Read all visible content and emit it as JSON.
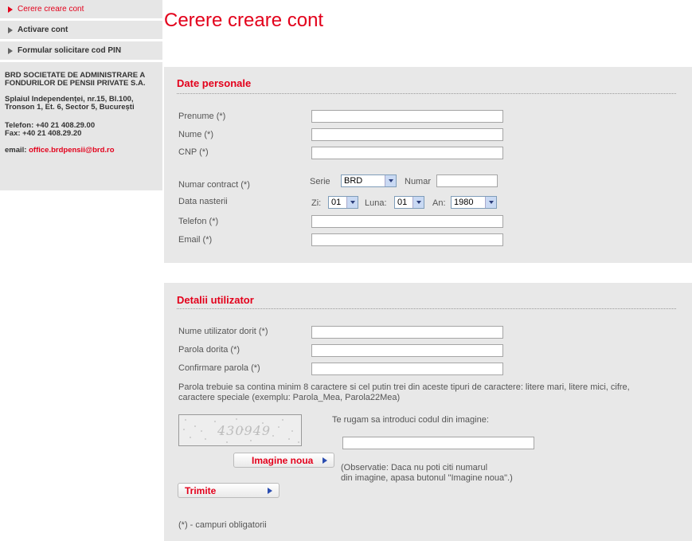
{
  "sidebar": {
    "items": [
      {
        "label": "Cerere creare cont"
      },
      {
        "label": "Activare cont"
      },
      {
        "label": "Formular solicitare cod PIN"
      }
    ],
    "company_line1": "BRD SOCIETATE DE ADMINISTRARE A",
    "company_line2": "FONDURILOR DE PENSII PRIVATE S.A.",
    "address_line1": "Splaiul Independenței, nr.15, Bl.100,",
    "address_line2": "Tronson 1, Et. 6, Sector 5, București",
    "phone": "Telefon: +40 21 408.29.00",
    "fax": "Fax: +40 21 408.29.20",
    "email_label": "email: ",
    "email_value": "office.brdpensii@brd.ro"
  },
  "page_title": "Cerere creare cont",
  "personal": {
    "title": "Date personale",
    "prenume": "Prenume (*)",
    "nume": "Nume (*)",
    "cnp": "CNP (*)",
    "contract": "Numar contract (*)",
    "serie_label": "Serie",
    "serie_value": "BRD",
    "numar_label": "Numar",
    "birth": "Data nasterii",
    "zi_label": "Zi:",
    "zi_value": "01",
    "luna_label": "Luna:",
    "luna_value": "01",
    "an_label": "An:",
    "an_value": "1980",
    "telefon": "Telefon (*)",
    "email": "Email (*)"
  },
  "user": {
    "title": "Detalii utilizator",
    "username": "Nume utilizator dorit (*)",
    "password": "Parola dorita (*)",
    "confirm": "Confirmare parola (*)",
    "password_note_line1": "Parola trebuie sa contina minim 8 caractere si cel putin trei din aceste tipuri de caractere: litere mari, litere mici, cifre,",
    "password_note_line2": "caractere speciale (exemplu: Parola_Mea, Parola22Mea)",
    "captcha_text": "430949",
    "captcha_prompt": "Te rugam sa introduci codul din imagine:",
    "new_image_button": "Imagine noua",
    "obs_line1": "(Observatie: Daca nu poti citi numarul",
    "obs_line2": "din imagine, apasa butonul \"Imagine noua\".)",
    "submit_button": "Trimite",
    "required_note": "(*) - campuri obligatorii"
  }
}
